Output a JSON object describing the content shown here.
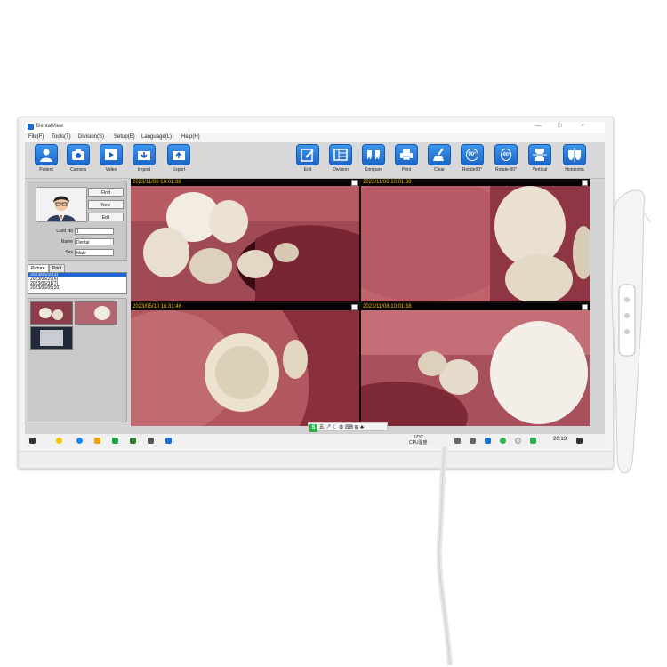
{
  "window": {
    "title": "DentalView",
    "controls": [
      "—",
      "□",
      "×"
    ]
  },
  "menu": [
    "File(F)",
    "Tools(T)",
    "Division(S)",
    "Setup(E)",
    "Language(L)",
    "Help(H)"
  ],
  "toolbar": {
    "left": [
      {
        "label": "Patient",
        "icon": "patient-icon"
      },
      {
        "label": "Camera",
        "icon": "camera-icon"
      },
      {
        "label": "Video",
        "icon": "video-icon"
      },
      {
        "label": "Import",
        "icon": "import-icon"
      },
      {
        "label": "Export",
        "icon": "export-icon"
      }
    ],
    "right": [
      {
        "label": "Edit",
        "icon": "edit-icon"
      },
      {
        "label": "Division",
        "icon": "division-icon"
      },
      {
        "label": "Compare",
        "icon": "compare-icon"
      },
      {
        "label": "Print",
        "icon": "print-icon"
      },
      {
        "label": "Clear",
        "icon": "clear-icon"
      },
      {
        "label": "Rotate90°",
        "icon": "rotate-90-icon",
        "glyph": "90°"
      },
      {
        "label": "Rotate-90°",
        "icon": "rotate-minus-90-icon",
        "glyph": "-90°"
      },
      {
        "label": "Vertical",
        "icon": "vertical-icon"
      },
      {
        "label": "Horizonta",
        "icon": "horizontal-icon"
      }
    ]
  },
  "patient": {
    "buttons": [
      "Find",
      "New",
      "Edit"
    ],
    "fields": [
      {
        "label": "Card No",
        "value": "1"
      },
      {
        "label": "Name",
        "value": "Dental"
      },
      {
        "label": "Sex",
        "value": "Male"
      }
    ]
  },
  "tabs": [
    "Picture",
    "Print"
  ],
  "dates": [
    "2023/05/10(3)",
    "2023/05/29(6)",
    "2023/05/31(7)",
    "2023/06/05(20)"
  ],
  "images": [
    {
      "timestamp": "2023/11/08 10:01:38"
    },
    {
      "timestamp": "2023/11/08 10:01:38"
    },
    {
      "timestamp": "2023/05/10 16:31:46"
    },
    {
      "timestamp": "2023/11/08 10:01:38"
    }
  ],
  "ime": {
    "logo": "S",
    "text": "五 ↗ ☾ ⚙ ⌨ ⊞ ♣"
  },
  "taskbar": {
    "temp": "37°C",
    "cpu": "CPU温度",
    "time": "20:13"
  },
  "colors": {
    "toolbar_blue": "#1f6dd0",
    "timestamp": "#e8c300",
    "selection": "#1e64d2"
  }
}
